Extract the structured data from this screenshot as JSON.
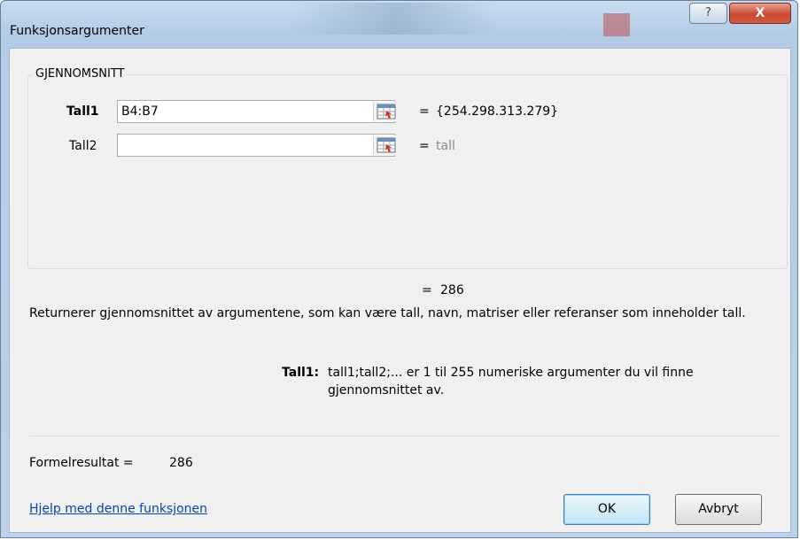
{
  "window": {
    "title": "Funksjonsargumenter",
    "help_button": "?",
    "close_button": "X"
  },
  "function_name": "GJENNOMSNITT",
  "arguments": [
    {
      "label": "Tall1",
      "value": "B4:B7",
      "result": "{254.298.313.279}",
      "bold": true
    },
    {
      "label": "Tall2",
      "value": "",
      "result": "tall",
      "bold": false
    }
  ],
  "equals_sign": "=",
  "function_result": "286",
  "description": "Returnerer gjennomsnittet av argumentene, som kan være tall, navn, matriser eller referanser som inneholder tall.",
  "arg_help": {
    "label": "Tall1:",
    "text_line1": "tall1;tall2;... er 1 til 255 numeriske argumenter du vil finne",
    "text_line2": "gjennomsnittet av."
  },
  "formula_result_label": "Formelresultat =",
  "formula_result_value": "286",
  "help_link": "Hjelp med denne funksjonen",
  "buttons": {
    "ok": "OK",
    "cancel": "Avbryt"
  }
}
